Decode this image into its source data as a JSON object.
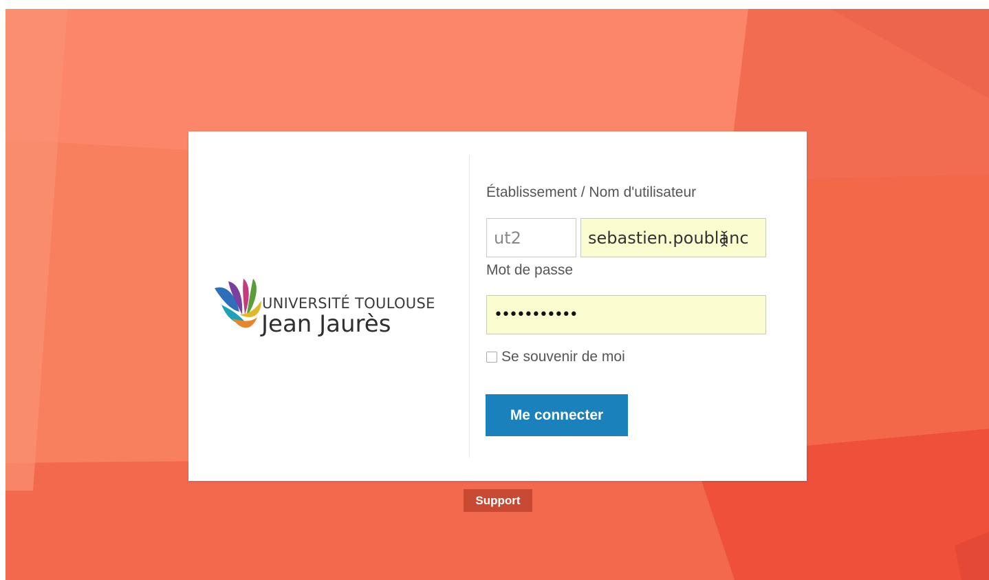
{
  "background": {
    "base_color": "#f7795b",
    "palette": [
      "#fb8a6b",
      "#f48466",
      "#f26a4c",
      "#ee5a3f",
      "#f9815f"
    ]
  },
  "logo": {
    "line1": "UNIVERSITÉ  TOULOUSE",
    "line2": "Jean Jaurès"
  },
  "form": {
    "username_label": "Établissement / Nom d'utilisateur",
    "domain_value": "ut2",
    "username_value": "sebastien.poublanc",
    "password_label": "Mot de passe",
    "password_value": "•••••••••••",
    "remember_label": "Se souvenir de moi",
    "remember_checked": false,
    "submit_label": "Me connecter",
    "field_highlight_color": "#fbfccf",
    "button_color": "#1a81bd"
  },
  "support": {
    "label": "Support",
    "color": "#c84a33"
  }
}
